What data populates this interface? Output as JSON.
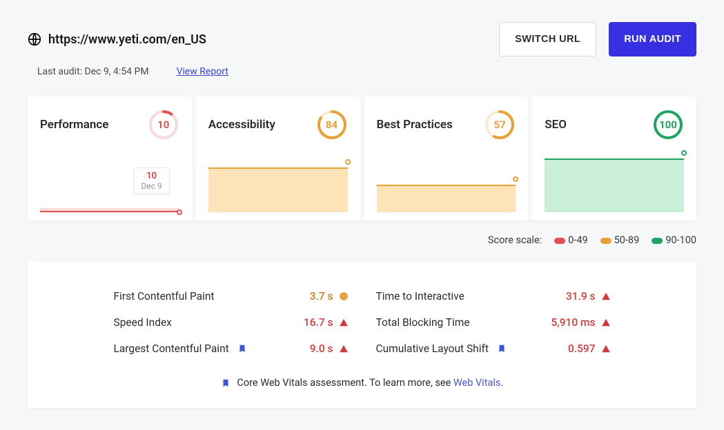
{
  "header": {
    "url": "https://www.yeti.com/en_US",
    "switch_url_label": "SWITCH URL",
    "run_audit_label": "RUN AUDIT",
    "last_audit_prefix": "Last audit:",
    "last_audit_time": "Dec 9, 4:54 PM",
    "view_report_label": "View Report"
  },
  "colors": {
    "red": "#e05050",
    "amber": "#e8a03a",
    "green": "#1fa463",
    "red_fill": "#fbdada",
    "amber_fill": "#fde3b8",
    "green_fill": "#c9efd8",
    "primary": "#3730e3",
    "bookmark": "#3c55d6"
  },
  "cards": {
    "performance": {
      "title": "Performance",
      "score": 10,
      "tier": "red",
      "tooltip_value": "10",
      "tooltip_date": "Dec 9",
      "area_height_pct": 4
    },
    "accessibility": {
      "title": "Accessibility",
      "score": 84,
      "tier": "amber",
      "area_height_pct": 72
    },
    "best_practices": {
      "title": "Best Practices",
      "score": 57,
      "tier": "amber",
      "area_height_pct": 44
    },
    "seo": {
      "title": "SEO",
      "score": 100,
      "tier": "green",
      "area_height_pct": 87
    }
  },
  "score_scale": {
    "label": "Score scale:",
    "ranges": [
      {
        "text": "0-49",
        "color": "#e05050"
      },
      {
        "text": "50-89",
        "color": "#e8a03a"
      },
      {
        "text": "90-100",
        "color": "#1fa463"
      }
    ]
  },
  "metrics": {
    "left": [
      {
        "label": "First Contentful Paint",
        "value": "3.7 s",
        "status": "amber",
        "bookmark": false
      },
      {
        "label": "Speed Index",
        "value": "16.7 s",
        "status": "red",
        "bookmark": false
      },
      {
        "label": "Largest Contentful Paint",
        "value": "9.0 s",
        "status": "red",
        "bookmark": true
      }
    ],
    "right": [
      {
        "label": "Time to Interactive",
        "value": "31.9 s",
        "status": "red",
        "bookmark": false
      },
      {
        "label": "Total Blocking Time",
        "value": "5,910 ms",
        "status": "red",
        "bookmark": false
      },
      {
        "label": "Cumulative Layout Shift",
        "value": "0.597",
        "status": "red",
        "bookmark": true
      }
    ]
  },
  "vitals_footer": {
    "text_prefix": "Core Web Vitals assessment. To learn more, see ",
    "link_text": "Web Vitals",
    "text_suffix": "."
  },
  "chart_data": [
    {
      "type": "line",
      "title": "Performance",
      "categories": [
        "Dec 9"
      ],
      "values": [
        10
      ],
      "ylim": [
        0,
        100
      ]
    },
    {
      "type": "line",
      "title": "Accessibility",
      "categories": [
        "Dec 9"
      ],
      "values": [
        84
      ],
      "ylim": [
        0,
        100
      ]
    },
    {
      "type": "line",
      "title": "Best Practices",
      "categories": [
        "Dec 9"
      ],
      "values": [
        57
      ],
      "ylim": [
        0,
        100
      ]
    },
    {
      "type": "line",
      "title": "SEO",
      "categories": [
        "Dec 9"
      ],
      "values": [
        100
      ],
      "ylim": [
        0,
        100
      ]
    }
  ]
}
